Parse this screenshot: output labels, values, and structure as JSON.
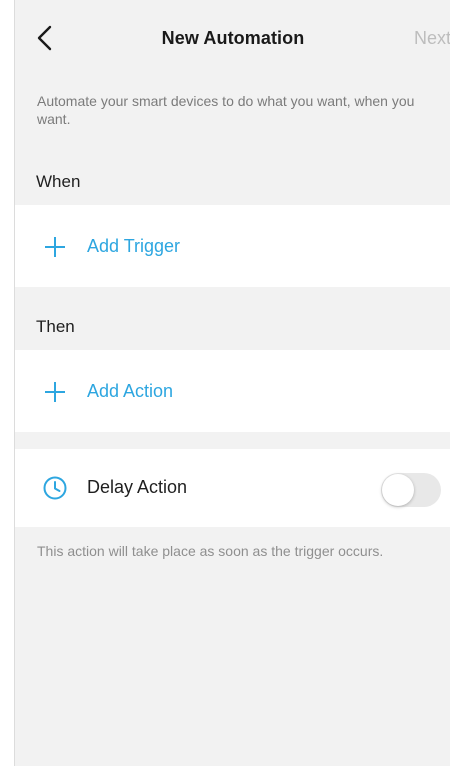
{
  "header": {
    "title": "New Automation",
    "next_label": "Next"
  },
  "description": "Automate your smart devices to do what you want, when you want.",
  "when": {
    "label": "When",
    "add_label": "Add Trigger"
  },
  "then": {
    "label": "Then",
    "add_label": "Add Action"
  },
  "delay": {
    "label": "Delay Action",
    "enabled": false,
    "note": "This action will take place as soon as the trigger occurs."
  },
  "colors": {
    "accent": "#2da6e0",
    "background": "#f2f2f2",
    "next_disabled": "#bdbdbd"
  },
  "icons": {
    "back": "chevron-left-icon",
    "add": "plus-icon",
    "delay": "clock-icon"
  }
}
